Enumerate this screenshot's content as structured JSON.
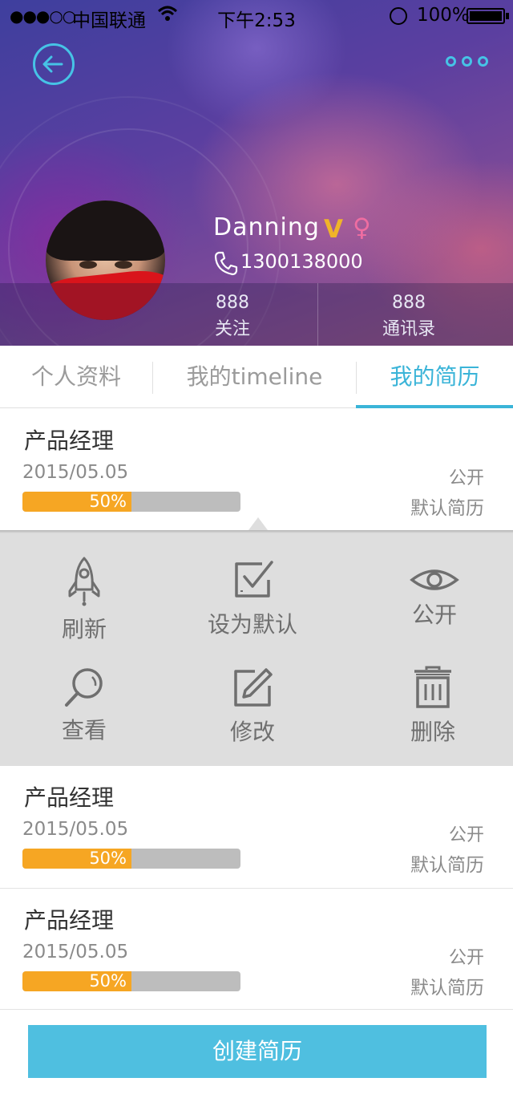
{
  "status_bar": {
    "signal": "●●●○○",
    "carrier": "中国联通",
    "wifi_icon": "wifi-icon",
    "time": "下午2:53",
    "battery_text": "100%"
  },
  "profile": {
    "name": "Danning",
    "verified_badge": "V",
    "gender_symbol": "♀",
    "phone": "1300138000",
    "stats": [
      {
        "count": "888",
        "label": "关注"
      },
      {
        "count": "888",
        "label": "通讯录"
      }
    ]
  },
  "tabs": [
    {
      "label": "个人资料",
      "active": false
    },
    {
      "label": "我的timeline",
      "active": false
    },
    {
      "label": "我的简历",
      "active": true
    }
  ],
  "resumes": [
    {
      "title": "产品经理",
      "date": "2015/05.05",
      "progress": 0.5,
      "progress_label": "50%",
      "visibility": "公开",
      "default_label": "默认简历"
    },
    {
      "title": "产品经理",
      "date": "2015/05.05",
      "progress": 0.5,
      "progress_label": "50%",
      "visibility": "公开",
      "default_label": "默认简历"
    },
    {
      "title": "产品经理",
      "date": "2015/05.05",
      "progress": 0.5,
      "progress_label": "50%",
      "visibility": "公开",
      "default_label": "默认简历"
    }
  ],
  "actions": [
    {
      "label": "刷新",
      "icon": "rocket-icon"
    },
    {
      "label": "设为默认",
      "icon": "checkbox-icon"
    },
    {
      "label": "公开",
      "icon": "eye-icon"
    },
    {
      "label": "查看",
      "icon": "magnifier-icon"
    },
    {
      "label": "修改",
      "icon": "edit-icon"
    },
    {
      "label": "删除",
      "icon": "trash-icon"
    }
  ],
  "create_button": "创建简历",
  "colors": {
    "accent": "#3ab4d8",
    "button": "#4fbfe0",
    "progress": "#f6a623",
    "progress_track": "#bdbdbd",
    "panel": "#dedede"
  }
}
